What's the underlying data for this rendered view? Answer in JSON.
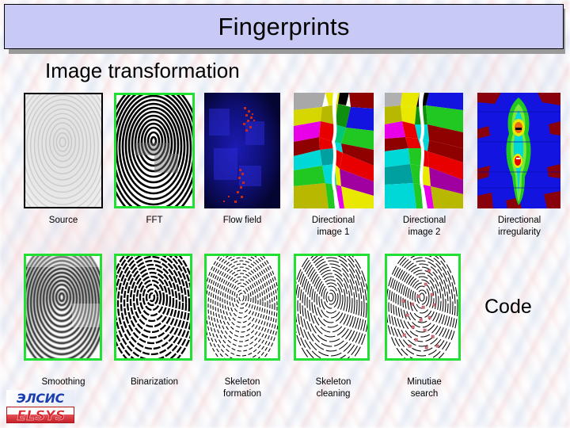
{
  "slide": {
    "title": "Fingerprints",
    "section_heading": "Image transformation",
    "code_label": "Code",
    "title_bg_color": "#c9c9f5",
    "title_border_color": "#000000",
    "title_shadow_color": "#9a9a9a",
    "thumb_border_green": "#22e033",
    "background_style": "pale diagonal fingerprint ridge wash, pink and blue on white"
  },
  "logo": {
    "top_text": "ЭЛСИС",
    "bottom_text": "ELSYS",
    "top_color": "#1a3fb0",
    "bottom_color": "#d8262e"
  },
  "rows": [
    {
      "name": "image-transformation-row",
      "panels": [
        {
          "caption": "Source",
          "kind": "gray-fingerprint-light",
          "border": "black"
        },
        {
          "caption": "FFT",
          "kind": "bw-fingerprint-contrast",
          "border": "green"
        },
        {
          "caption": "Flow field",
          "kind": "flow-field-dark-blue",
          "border": "none"
        },
        {
          "caption": "Directional\nimage 1",
          "kind": "directional-falsecolor-1",
          "border": "none"
        },
        {
          "caption": "Directional\nimage 2",
          "kind": "directional-falsecolor-2",
          "border": "none"
        },
        {
          "caption": "Directional\nirregularity",
          "kind": "irregularity-heatmap",
          "border": "none"
        }
      ]
    },
    {
      "name": "code-row",
      "panels": [
        {
          "caption": "Smoothing",
          "kind": "gray-fingerprint-smooth",
          "border": "green"
        },
        {
          "caption": "Binarization",
          "kind": "binary-fingerprint",
          "border": "green"
        },
        {
          "caption": "Skeleton\nformation",
          "kind": "skeleton-raw",
          "border": "green"
        },
        {
          "caption": "Skeleton\ncleaning",
          "kind": "skeleton-clean",
          "border": "green"
        },
        {
          "caption": "Minutiae\nsearch",
          "kind": "minutiae-marked",
          "border": "green"
        }
      ]
    }
  ]
}
